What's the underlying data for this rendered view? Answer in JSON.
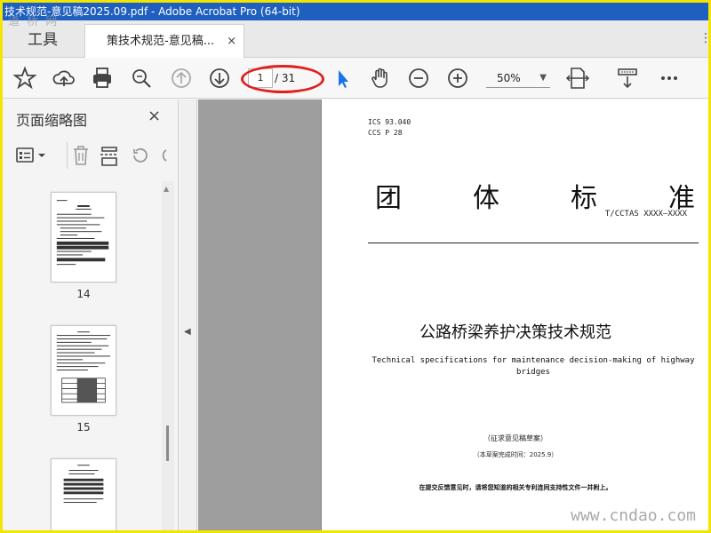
{
  "window": {
    "title": "技术规范-意见稿2025.09.pdf - Adobe Acrobat Pro (64-bit)"
  },
  "watermarks": {
    "top_left": "道 桥 网",
    "bottom_right": "www.cndao.com"
  },
  "tabs": {
    "tools_label": "工具",
    "document_label": "策技术规范-意见稿...",
    "close_glyph": "×"
  },
  "toolbar": {
    "icons": [
      "star-icon",
      "upload-cloud-icon",
      "print-icon",
      "search-zoom-icon",
      "page-up-icon",
      "page-down-icon",
      "select-arrow-icon",
      "hand-icon",
      "zoom-out-icon",
      "zoom-in-icon",
      "fit-page-icon",
      "scroll-mode-icon",
      "more-icon"
    ],
    "page_current": "1",
    "page_total": "/ 31",
    "zoom": "50%"
  },
  "thumbnails_pane": {
    "title": "页面缩略图",
    "close_glyph": "×",
    "pages": [
      {
        "label": "14"
      },
      {
        "label": "15"
      },
      {
        "label": ""
      }
    ]
  },
  "document": {
    "ics": "ICS  93.040",
    "ccs": "CCS  P 28",
    "big_title": [
      "团",
      "体",
      "标",
      "准"
    ],
    "standard_code": "T/CCTAS XXXX—XXXX",
    "title_cn": "公路桥梁养护决策技术规范",
    "title_en": "Technical specifications for maintenance decision-making of highway bridges",
    "draft": "（征求意见稿草案）",
    "date": "（本草案完成时间：2025.9）",
    "note": "在提交反馈意见时，请将您知道的相关专利连同支持性文件一并附上。"
  },
  "colors": {
    "titlebar": "#1f5fbf",
    "frame": "#f2e600",
    "highlight_oval": "#e02020",
    "select_arrow": "#1a73e8"
  }
}
